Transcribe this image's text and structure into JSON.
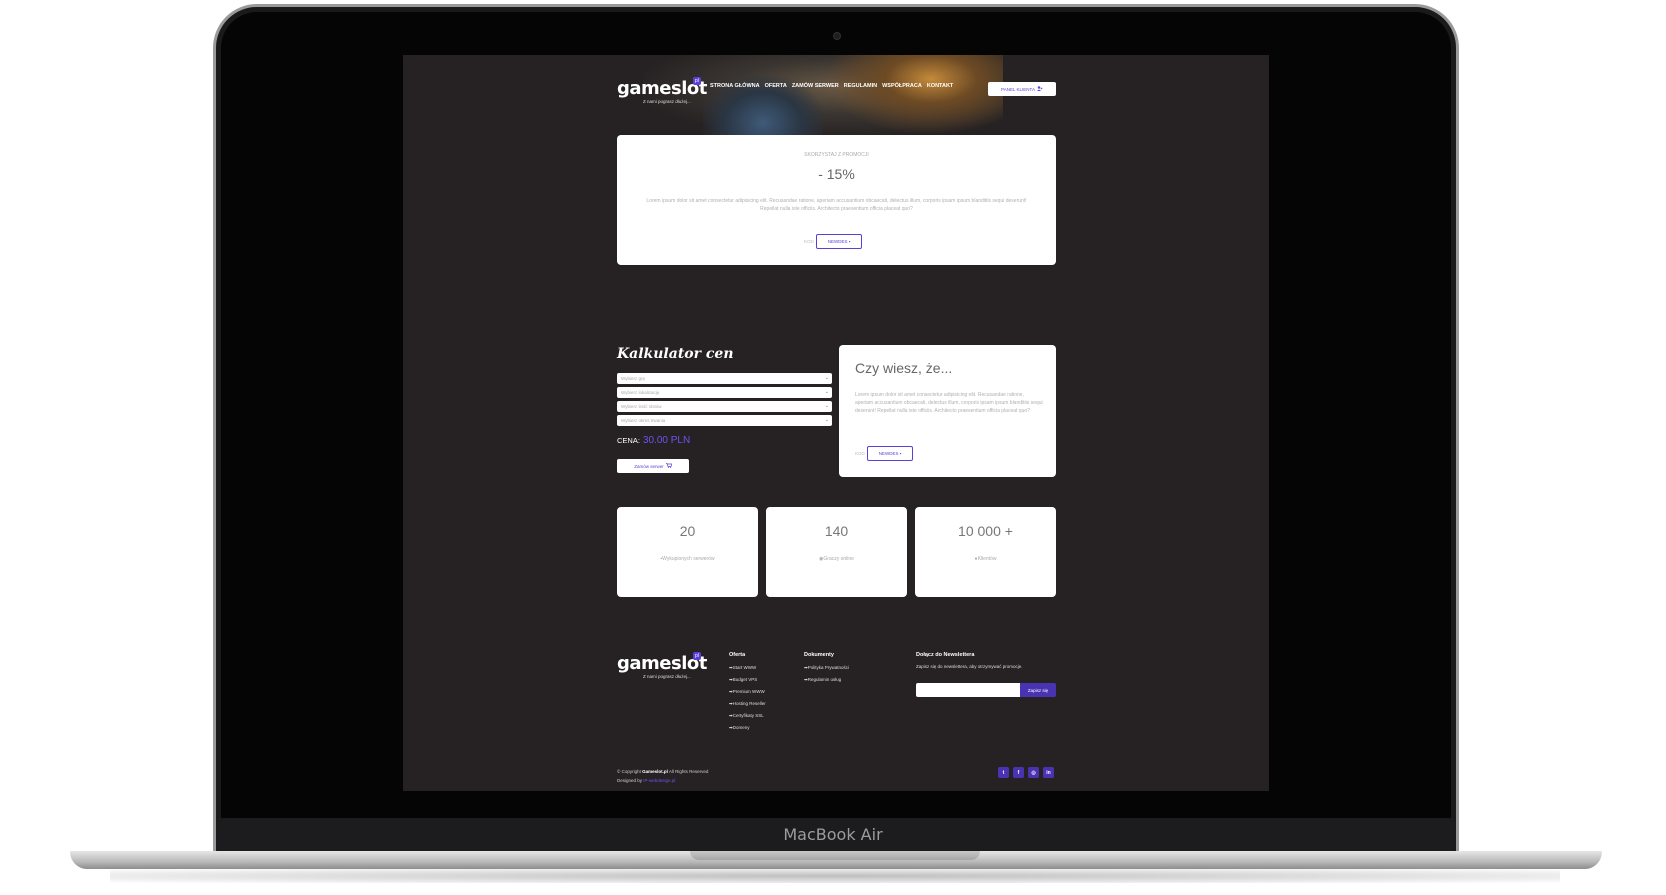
{
  "device": {
    "brand": "MacBook Air"
  },
  "header": {
    "logo": {
      "text": "gameslot",
      "badge": "pl",
      "tagline": "Z nami pograsz dłużej..."
    },
    "nav": [
      "STRONA GŁÓWNA",
      "OFERTA",
      "ZAMÓW SERWER",
      "REGULAMIN",
      "WSPÓŁPRACA",
      "KONTAKT"
    ],
    "panel_button": "PANEL KLIENTA",
    "panel_icon": "user-add-icon"
  },
  "promo": {
    "label": "SKORZYSTAJ Z PROMOCJI",
    "value": "- 15%",
    "text": "Lorem ipsum dolor sit amet consectetur adipisicing elit. Recusandae ratione, aperiam accusantium obcaecati, delectus illum, corporis ipsam ipsum blanditiis sequi deserunt! Repellat nulla iste officiis. Architecto praesentium officia placeat quo?",
    "code_label": "KOD",
    "code_button": "NEWDES"
  },
  "calculator": {
    "title": "Kalkulator cen",
    "selects": [
      "Wybierz grę",
      "Wybierz lokalizację",
      "Wybierz ilość slotów",
      "Wybierz okres trwania"
    ],
    "price_label": "CENA:",
    "price_value": "30.00 PLN",
    "order_button": "Zamów serwer"
  },
  "did_you_know": {
    "title": "Czy wiesz, że...",
    "text": "Lorem ipsum dolor sit amet consectetur adipisicing elit. Recusandae ratione, aperiam accusantium obcaecati, delectus illum, corporis ipsam ipsum blanditiis sequi deserunt! Repellat nulla iste officiis. Architecto praesentium officia placeat quo?",
    "code_label": "KOD",
    "code_button": "NEWDES"
  },
  "stats": [
    {
      "value": "20",
      "label": "Wykupionych serwerów",
      "icon": "server-icon"
    },
    {
      "value": "140",
      "label": "Graczy online",
      "icon": "users-icon"
    },
    {
      "value": "10 000 +",
      "label": "Klientów",
      "icon": "user-icon"
    }
  ],
  "footer": {
    "logo": {
      "text": "gameslot",
      "badge": "pl",
      "tagline": "Z nami pograsz dłużej..."
    },
    "oferta": {
      "title": "Oferta",
      "links": [
        "➡Start WWW",
        "➡Budget VPS",
        "➡Premium WWW",
        "➡Hosting Reseller",
        "➡Certyfikaty SSL",
        "➡Domeny"
      ]
    },
    "dokumenty": {
      "title": "Dokumenty",
      "links": [
        "➡Polityka Prywatności",
        "➡Regulamin usług"
      ]
    },
    "newsletter": {
      "title": "Dołącz do Newslettera",
      "text": "Zapisz się do newslettera, aby otrzymywać promocje.",
      "button": "Zapisz się"
    },
    "copyright_prefix": "© Copyright",
    "copyright_brand": "Gameslot.pl",
    "copyright_suffix": "All Rights Reserved",
    "designed_prefix": "Designed by",
    "designed_by": "IP-webdesign.pl",
    "socials": [
      "twitter-icon",
      "facebook-icon",
      "instagram-icon",
      "linkedin-icon"
    ]
  }
}
